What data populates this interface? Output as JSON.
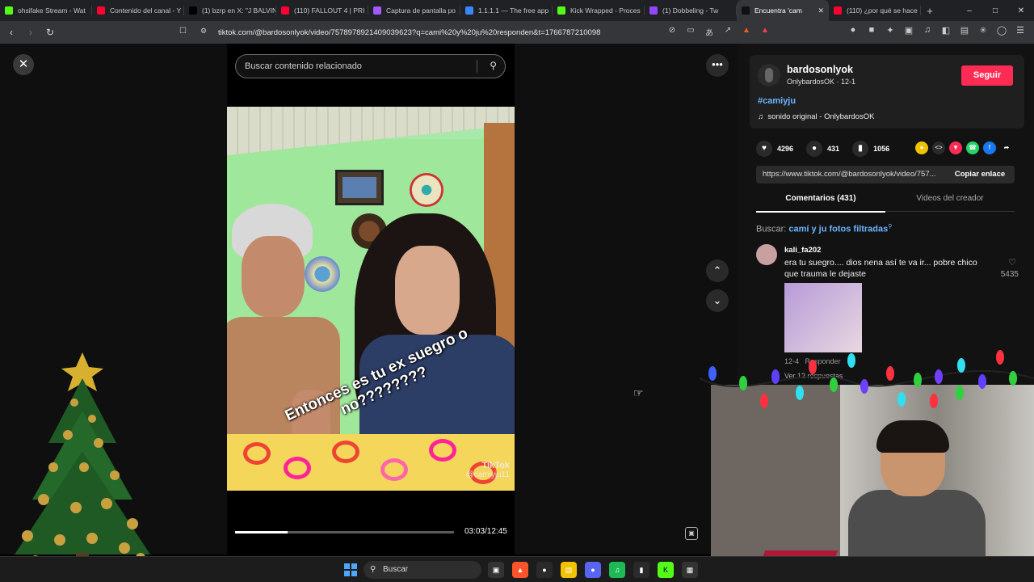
{
  "browser": {
    "tabs": [
      {
        "label": "ohsifake Stream - Wat",
        "icon": "kick-icon",
        "color": "#53fc18"
      },
      {
        "label": "Contenido del canal - Y",
        "icon": "youtube-icon",
        "color": "#ff0033"
      },
      {
        "label": "(1) bzrp en X: \"J BALVIN",
        "icon": "x-icon",
        "color": "#000000"
      },
      {
        "label": "(110) FALLOUT 4 | PRI",
        "icon": "youtube-icon",
        "color": "#ff0033"
      },
      {
        "label": "Captura de pantalla po",
        "icon": "pen-icon",
        "color": "#a259ff"
      },
      {
        "label": "1.1.1.1 — The free app",
        "icon": "cloudflare-icon",
        "color": "#3a86ff"
      },
      {
        "label": "Kick Wrapped - Proces",
        "icon": "kick-icon",
        "color": "#53fc18"
      },
      {
        "label": "(1) Dobbeling - Tw",
        "icon": "twitch-icon",
        "color": "#9146ff"
      },
      {
        "label": "Encuentra 'cam",
        "icon": "tiktok-icon",
        "color": "#111111"
      },
      {
        "label": "(110) ¿por qué se hace",
        "icon": "youtube-icon",
        "color": "#ff0033"
      }
    ],
    "url": "tiktok.com/@bardosonlyok/video/7578978921409039623?q=cami%20y%20ju%20responden&t=1766787210098"
  },
  "video": {
    "search_placeholder": "Buscar contenido relacionado",
    "caption": "Entonces es tu ex suegro o no????????",
    "watermark_brand": "TikTok",
    "watermark_user": "@camiyju11",
    "time": "03:03/12:45",
    "progress": 0.24
  },
  "author": {
    "name": "bardosonlyok",
    "sub": "OnlybardosOK · 12-1",
    "follow": "Seguir",
    "hashtag": "#camiyju",
    "sound": "sonido original - OnlybardosOK"
  },
  "stats": {
    "likes": "4296",
    "comments": "431",
    "saves": "1056"
  },
  "link": {
    "url": "https://www.tiktok.com/@bardosonlyok/video/757...",
    "copy": "Copiar enlace"
  },
  "tabs": {
    "comments": "Comentarios (431)",
    "creator": "Videos del creador"
  },
  "search_line": {
    "label": "Buscar: ",
    "query": "camí y ju fotos filtradas"
  },
  "comment": {
    "user": "kali_fa202",
    "text": "era tu suegro.... dios nena así te va ir... pobre chico que trauma le dejaste",
    "likes": "5435",
    "date": "12-4",
    "reply": "Responder",
    "more": "Ver 12 respuestas"
  },
  "taskbar": {
    "search": "Buscar"
  }
}
